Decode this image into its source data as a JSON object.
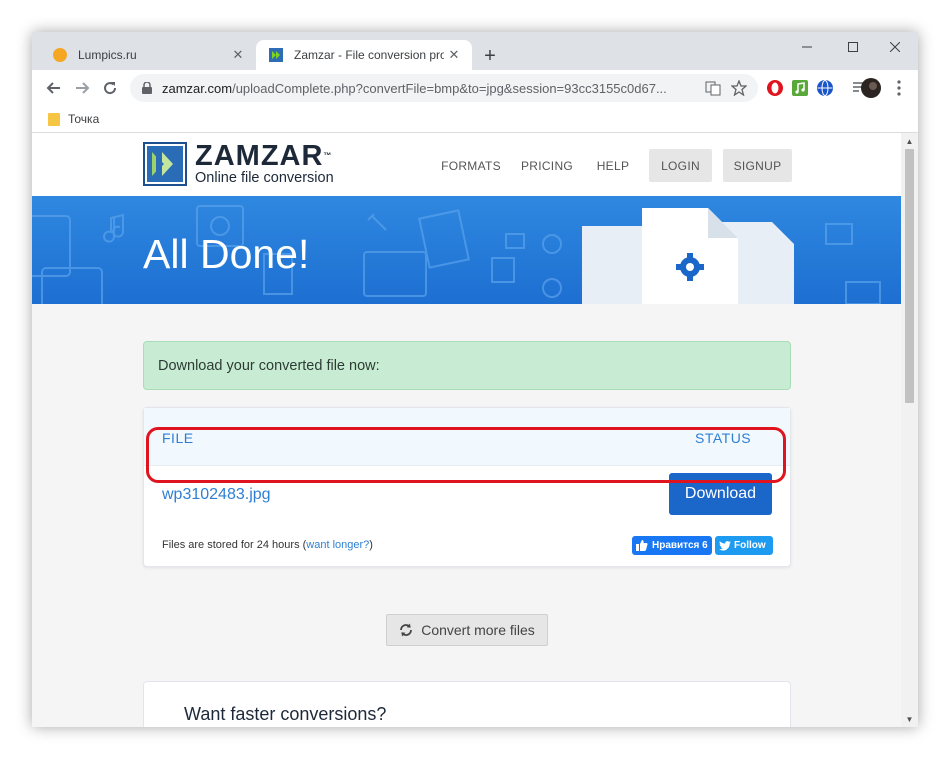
{
  "browser": {
    "tabs": [
      {
        "title": "Lumpics.ru",
        "active": false
      },
      {
        "title": "Zamzar - File conversion progress",
        "active": true
      }
    ],
    "address": {
      "host": "zamzar.com",
      "path": "/uploadComplete.php?convertFile=bmp&to=jpg&session=93cc3155c0d67..."
    },
    "bookmarks": [
      {
        "label": "Точка"
      }
    ]
  },
  "site": {
    "logo": {
      "name": "ZAMZAR",
      "tm": "™",
      "tagline": "Online file conversion"
    },
    "nav": {
      "formats": "FORMATS",
      "pricing": "PRICING",
      "help": "HELP",
      "login": "LOGIN",
      "signup": "SIGNUP"
    },
    "hero_title": "All Done!"
  },
  "main": {
    "alert": "Download your converted file now:",
    "table": {
      "col_file": "FILE",
      "col_status": "STATUS",
      "file_name": "wp3102483.jpg",
      "download_label": "Download"
    },
    "stored_prefix": "Files are stored for 24 hours (",
    "stored_link": "want longer?",
    "stored_suffix": ")",
    "fb_label": "Нравится 6",
    "tw_label": "Follow",
    "convert_more": "Convert more files",
    "promo_title": "Want faster conversions?"
  },
  "colors": {
    "accent": "#1a66c9",
    "hero": "#2f88e0",
    "alert_bg": "#c8ecd3",
    "highlight": "#e0141e"
  }
}
